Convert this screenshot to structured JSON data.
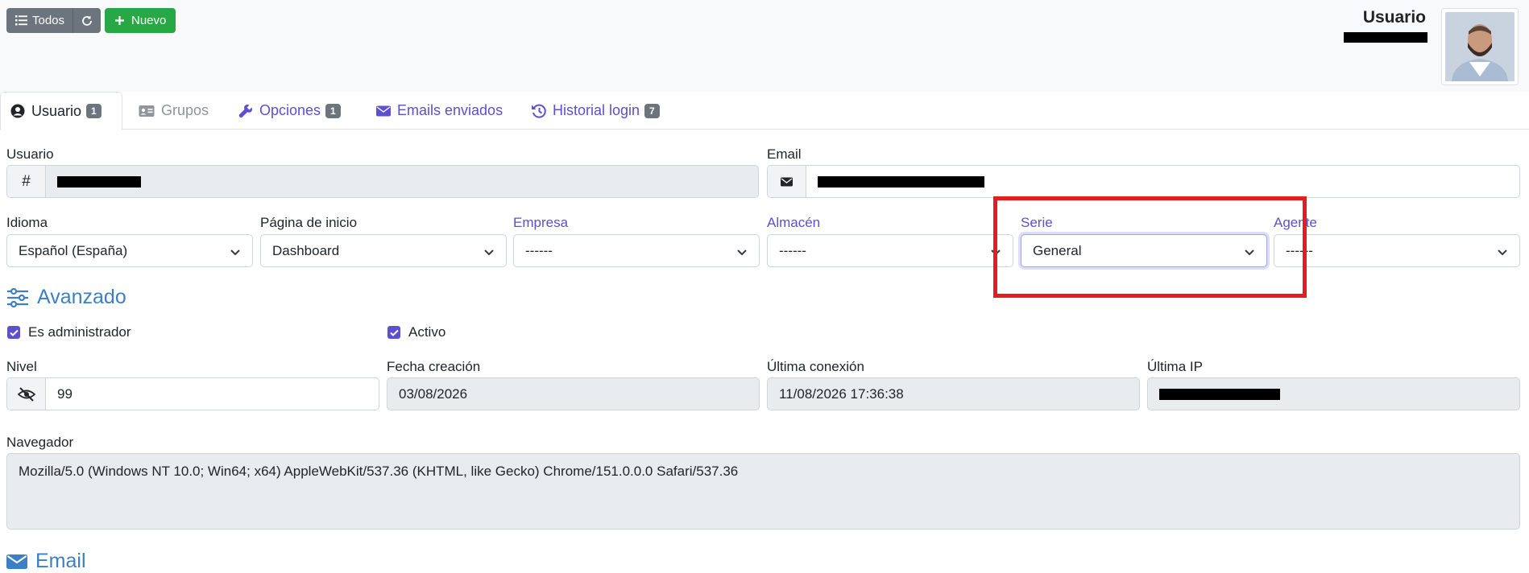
{
  "toolbar": {
    "todos_label": "Todos",
    "nuevo_label": "Nuevo"
  },
  "header": {
    "user_title": "Usuario"
  },
  "tabs": [
    {
      "label": "Usuario",
      "badge": "1",
      "icon": "user-circle-icon",
      "state": "active"
    },
    {
      "label": "Grupos",
      "icon": "id-card-icon",
      "state": "disabled"
    },
    {
      "label": "Opciones",
      "badge": "1",
      "icon": "wrench-icon"
    },
    {
      "label": "Emails enviados",
      "icon": "envelope-icon"
    },
    {
      "label": "Historial login",
      "badge": "7",
      "icon": "history-icon"
    }
  ],
  "fields": {
    "usuario": {
      "label": "Usuario",
      "addon": "#"
    },
    "email": {
      "label": "Email"
    },
    "idioma": {
      "label": "Idioma",
      "value": "Español (España)"
    },
    "pagina_inicio": {
      "label": "Página de inicio",
      "value": "Dashboard"
    },
    "empresa": {
      "label": "Empresa",
      "value": "------"
    },
    "almacen": {
      "label": "Almacén",
      "value": "------"
    },
    "serie": {
      "label": "Serie",
      "value": "General"
    },
    "agente": {
      "label": "Agente",
      "value": "------"
    }
  },
  "advanced": {
    "title": "Avanzado",
    "es_admin_label": "Es administrador",
    "es_admin_checked": true,
    "activo_label": "Activo",
    "activo_checked": true,
    "nivel": {
      "label": "Nivel",
      "value": "99"
    },
    "fecha_creacion": {
      "label": "Fecha creación",
      "value": "03/08/2026"
    },
    "ultima_conexion": {
      "label": "Última conexión",
      "value": "11/08/2026 17:36:38"
    },
    "ultima_ip": {
      "label": "Última IP"
    },
    "navegador": {
      "label": "Navegador",
      "value": "Mozilla/5.0 (Windows NT 10.0; Win64; x64) AppleWebKit/537.36 (KHTML, like Gecko) Chrome/151.0.0.0 Safari/537.36"
    }
  },
  "email_section": {
    "title": "Email"
  },
  "colors": {
    "accent": "#5c4fd1",
    "section_title": "#3d7fc4",
    "highlight": "#e41e1e",
    "success": "#28a745",
    "secondary": "#6c757d"
  }
}
